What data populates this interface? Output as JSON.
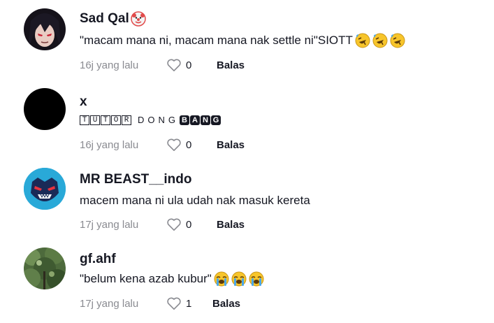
{
  "comments": [
    {
      "username": "Sad Qal",
      "username_emoji": "clown-face-icon",
      "text": "\"macam mana ni, macam mana nak settle ni\"SIOTT",
      "text_emojis": [
        "rolling-laughing-icon",
        "rolling-laughing-icon",
        "rolling-laughing-icon"
      ],
      "time": "16j yang lalu",
      "likes": "0",
      "reply_label": "Balas"
    },
    {
      "username": "x",
      "text_boxed": "TUTOR",
      "text_spaced": "DONG",
      "text_negative": "BANG",
      "time": "16j yang lalu",
      "likes": "0",
      "reply_label": "Balas"
    },
    {
      "username": "MR BEAST__indo",
      "text": "macem mana ni ula udah nak masuk kereta",
      "time": "17j yang lalu",
      "likes": "0",
      "reply_label": "Balas"
    },
    {
      "username": "gf.ahf",
      "text": "\"belum kena azab kubur\"",
      "text_emojis": [
        "loudly-crying-icon",
        "loudly-crying-icon",
        "loudly-crying-icon"
      ],
      "time": "17j yang lalu",
      "likes": "1",
      "reply_label": "Balas"
    }
  ],
  "colors": {
    "text": "#161823",
    "muted": "#8a8b91",
    "avatar_beast": "#29a9d8"
  }
}
